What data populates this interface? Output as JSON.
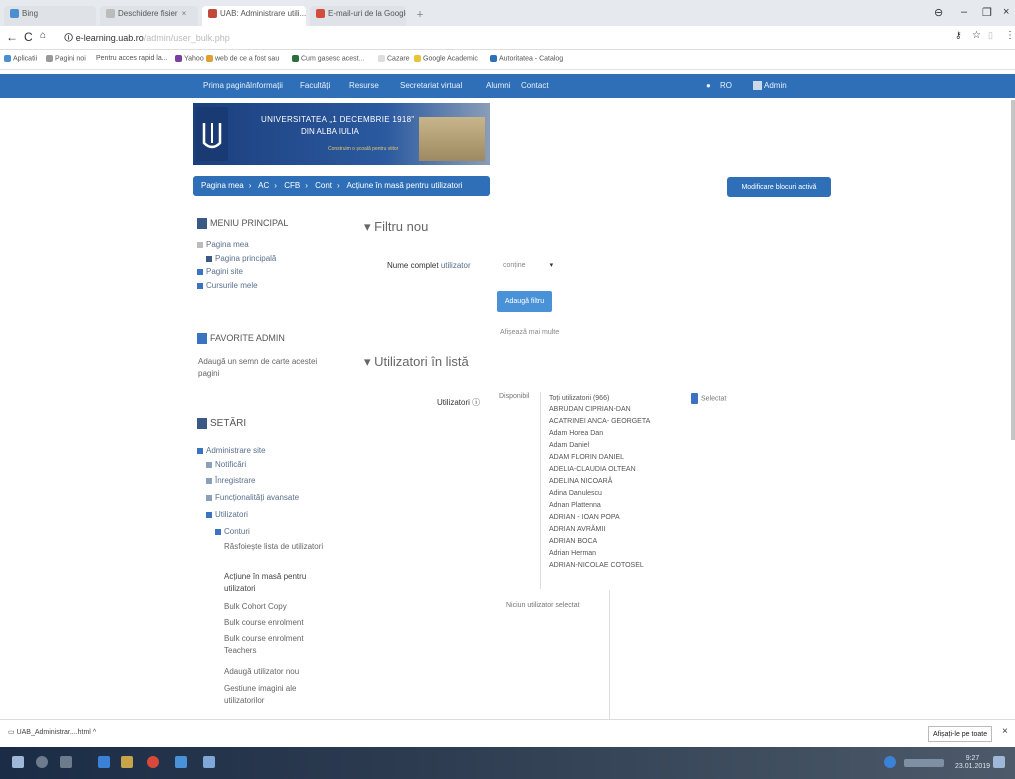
{
  "browser": {
    "tabs": [
      {
        "label": "Bing"
      },
      {
        "label": "Deschidere fisier"
      },
      {
        "label": "UAB: Administrare utili..."
      },
      {
        "label": "E-mail-uri de la Google"
      }
    ],
    "url": "e-learning.uab.ro",
    "url_rest": "/admin/user_bulk.php",
    "bookmarks": [
      "Aplicatii",
      "Pagini noi",
      "Pentru acces rapid la...",
      "Yahoo",
      "web de ce a fost sau",
      "Cum gasesc acest...",
      "Cazare",
      "Google Academic",
      "Autoritatea - Catalog"
    ],
    "accent": "#2e6fb7"
  },
  "site": {
    "nav": [
      "Prima pagină",
      "Informații",
      "Facultăți",
      "Resurse",
      "Secretariat virtual",
      "Alumni",
      "Contact"
    ],
    "nav_right": [
      "RO",
      "Admin"
    ],
    "banner": {
      "line1": "UNIVERSITATEA „1 DECEMBRIE 1918\"",
      "line2": "DIN ALBA IULIA",
      "tagline": "Construim o școală pentru viitor"
    },
    "breadcrumb": [
      "Pagina mea",
      "AC",
      "CFB",
      "Cont",
      "Acțiune în masă pentru utilizatori"
    ],
    "edit_button": "Modificare blocuri activă"
  },
  "left": {
    "menu_title": "MENIU PRINCIPAL",
    "menu_items": [
      "Pagina mea",
      "Pagina principală",
      "Pagini site",
      "Cursurile mele"
    ],
    "favorites_title": "FAVORITE ADMIN",
    "favorites_text": "Adaugă un semn de carte acestei pagini",
    "settings_title": "SETĂRI",
    "settings_items": [
      "Administrare site",
      "Notificări",
      "Înregistrare",
      "Funcționalități avansate",
      "Utilizatori",
      "Conturi",
      "Răsfoiește lista de utilizatori",
      "Acțiune în masă pentru utilizatori",
      "Bulk Cohort Copy",
      "Bulk course enrolment",
      "Bulk course enrolment Teachers",
      "Adaugă utilizator nou",
      "Gestiune imagini ale utilizatorilor"
    ]
  },
  "main": {
    "filter_title": "Filtru nou",
    "filter_label_1": "Nume complet",
    "filter_label_2": "utilizator",
    "filter_select": "conține",
    "add_filter_button": "Adaugă filtru",
    "show_more": "Afișează mai multe",
    "list_title": "Utilizatori în listă",
    "users_label": "Utilizatori",
    "available_label": "Disponibil",
    "users": [
      "Toți utilizatorii (966)",
      "ABRUDAN CIPRIAN-DAN",
      "ACATRINEI ANCA- GEORGETA",
      "Adam Horea Dan",
      "Adam Daniel",
      "ADAM FLORIN DANIEL",
      "ADELIA-CLAUDIA OLTEAN",
      "ADELINA NICOARĂ",
      "Adina Danulescu",
      "Adnan Plattenna",
      "ADRIAN - IOAN POPA",
      "ADRIAN AVRĂMII",
      "ADRIAN BOCA",
      "Adrian Herman",
      "ADRIAN-NICOLAE COTOSEL"
    ],
    "selected_label": "Selectat",
    "no_users_selected": "Niciun utilizator selectat"
  },
  "downloads": {
    "item": "UAB_Administrar....html",
    "show_all": "Afișați-le pe toate"
  },
  "taskbar": {
    "time": "9:27",
    "date": "23.01.2019"
  }
}
